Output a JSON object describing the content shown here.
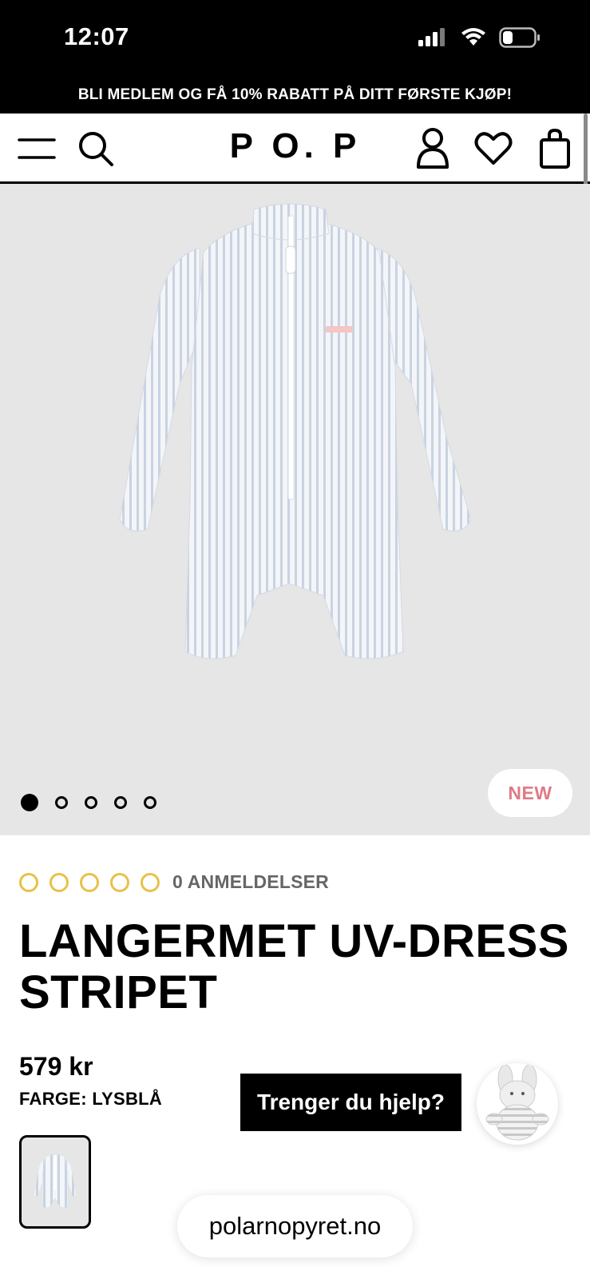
{
  "status_bar": {
    "time": "12:07"
  },
  "promo": {
    "text": "BLI MEDLEM OG FÅ 10% RABATT PÅ DITT FØRSTE KJØP!"
  },
  "header": {
    "logo": "P O. P",
    "icons": [
      "menu-icon",
      "search-icon",
      "account-icon",
      "heart-icon",
      "bag-icon"
    ]
  },
  "hero": {
    "badge": "NEW",
    "slides_total": 5,
    "active_slide": 1
  },
  "product": {
    "rating_count_label": "0 ANMELDELSER",
    "title": "LANGERMET UV-DRESS STRIPET",
    "price": "579 kr",
    "color_line": "FARGE: LYSBLÅ"
  },
  "help": {
    "label": "Trenger du hjelp?"
  },
  "browser": {
    "url": "polarnopyret.no"
  },
  "colors": {
    "star": "#e8c14a",
    "new_badge_text": "#e07a86",
    "hero_bg": "#e5e6e5"
  }
}
